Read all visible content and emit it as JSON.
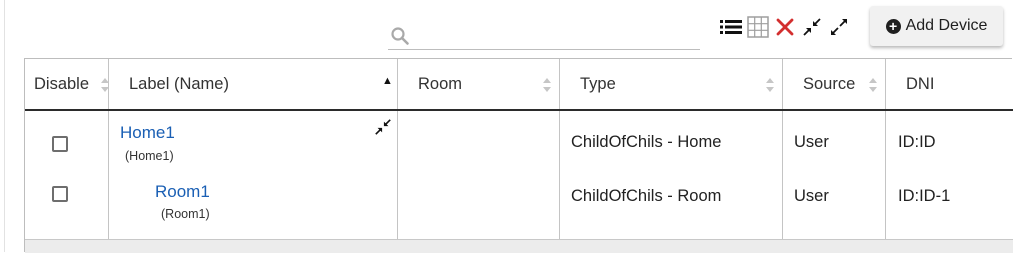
{
  "toolbar": {
    "search_value": "",
    "add_device_label": "Add Device",
    "icons": [
      "search-icon",
      "list-view-icon",
      "grid-view-icon",
      "clear-filter-icon",
      "collapse-icon",
      "expand-icon",
      "plus-circle-icon"
    ]
  },
  "table": {
    "columns": [
      {
        "label": "Disable",
        "sort": "none"
      },
      {
        "label": "Label (Name)",
        "sort": "ascending"
      },
      {
        "label": "Room",
        "sort": "none"
      },
      {
        "label": "Type",
        "sort": "none"
      },
      {
        "label": "Source",
        "sort": "none"
      },
      {
        "label": "DNI",
        "sort": "none"
      }
    ],
    "rows": [
      {
        "disabled": false,
        "label": "Home1",
        "name": "(Home1)",
        "room": "",
        "type": "ChildOfChils - Home",
        "source": "User",
        "dni": "ID:ID",
        "group_toggle_icon": "collapse-icon"
      },
      {
        "disabled": false,
        "label": "Room1",
        "name": "(Room1)",
        "room": "",
        "type": "ChildOfChils - Room",
        "source": "User",
        "dni": "ID:ID-1"
      }
    ]
  },
  "colors": {
    "link": "#1a5fb4",
    "delete_x": "#d32f2f",
    "header_rule": "#2b2b2b",
    "button_bg": "#f1f1f1"
  }
}
